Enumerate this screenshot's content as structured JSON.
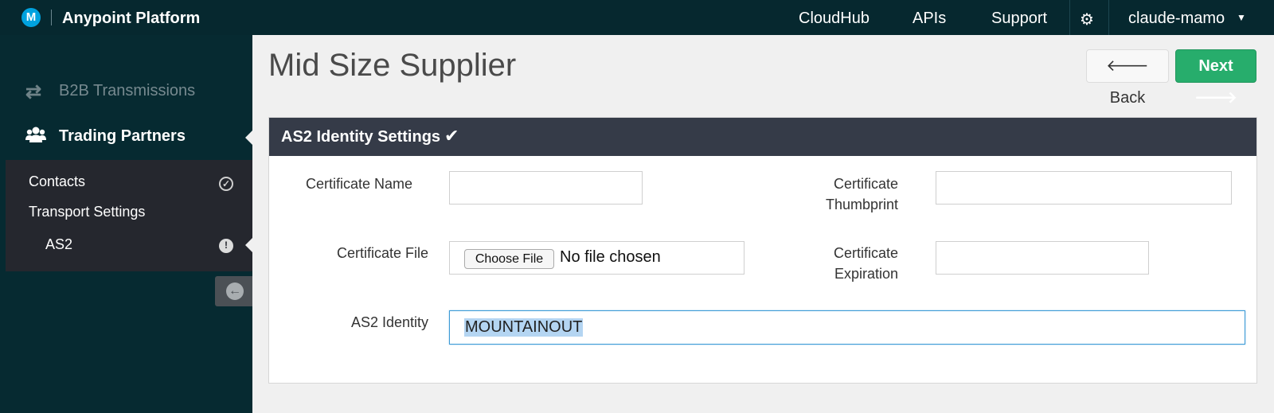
{
  "topbar": {
    "brand": "Anypoint Platform",
    "logo_letter": "M",
    "nav": [
      "CloudHub",
      "APIs",
      "Support"
    ],
    "user": "claude-mamo",
    "icons": {
      "logo": "mulesoft-logo-icon",
      "settings": "gear-icon",
      "user_menu": "caret-down-icon"
    }
  },
  "sidebar": {
    "items": [
      {
        "label": "B2B Transmissions",
        "icon": "transfer-arrows-icon"
      },
      {
        "label": "Trading Partners",
        "icon": "users-icon"
      }
    ],
    "subitems": [
      {
        "label": "Contacts",
        "status": "complete"
      },
      {
        "label": "Transport Settings"
      },
      {
        "label": "AS2",
        "status": "warning"
      }
    ]
  },
  "page": {
    "title": "Mid Size Supplier",
    "back_label": "Back",
    "next_label": "Next"
  },
  "panel": {
    "title": "AS2 Identity Settings",
    "fields": {
      "cert_name_label": "Certificate Name",
      "cert_name_value": "",
      "cert_thumb_label": "Certificate Thumbprint",
      "cert_thumb_value": "",
      "cert_file_label": "Certificate File",
      "choose_file_label": "Choose File",
      "file_status": "No file chosen",
      "cert_exp_label": "Certificate Expiration",
      "cert_exp_value": "",
      "as2_identity_label": "AS2 Identity",
      "as2_identity_value": "MOUNTAINOUT"
    }
  },
  "colors": {
    "topbar": "#06282f",
    "sidebar": "#062a31",
    "subnav": "#25272e",
    "panel_header": "#353b48",
    "next_button": "#27ad6c",
    "focus": "#3b9ad6"
  }
}
